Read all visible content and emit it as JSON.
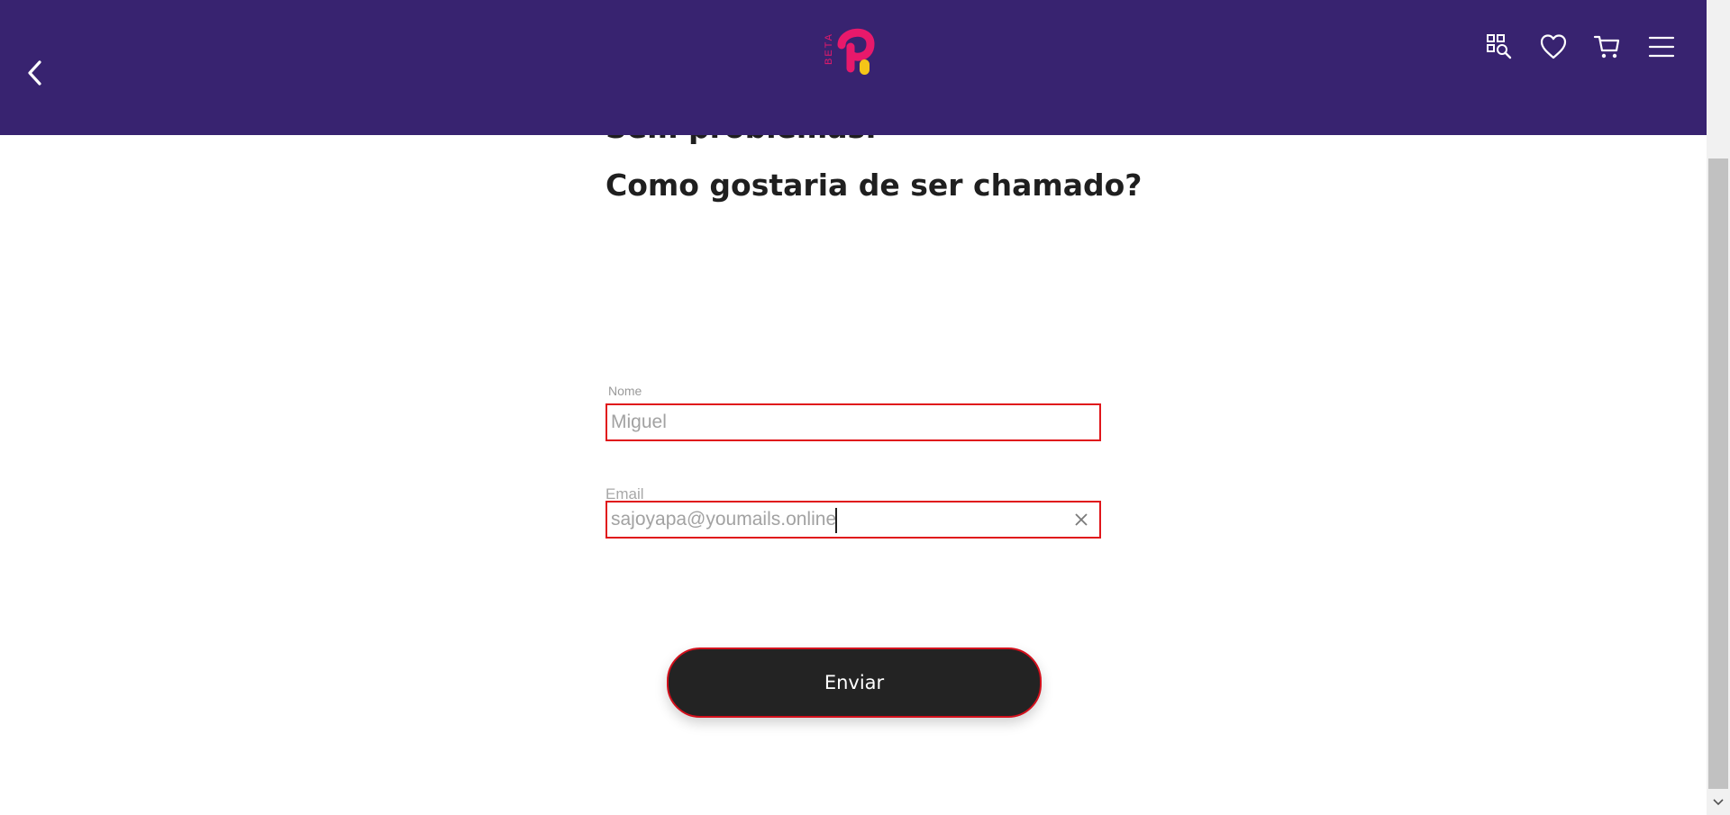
{
  "header": {
    "logo_badge": "BETA",
    "logo_colors": {
      "primary": "#e8196b",
      "accent": "#f5c518"
    },
    "background": "#382370",
    "icons": [
      "chevron-left-icon",
      "browse-search-icon",
      "heart-icon",
      "cart-icon",
      "menu-icon"
    ]
  },
  "main": {
    "previous_heading": "Sem problemas.",
    "question": "Como gostaria de ser chamado?",
    "name_field": {
      "label": "Nome",
      "value": "Miguel"
    },
    "email_field": {
      "label": "Email",
      "value": "sajoyapa@youmails.online"
    },
    "submit_label": "Enviar"
  },
  "colors": {
    "error_border": "#e0161b",
    "button_bg": "#232323",
    "button_text": "#ffffff"
  }
}
